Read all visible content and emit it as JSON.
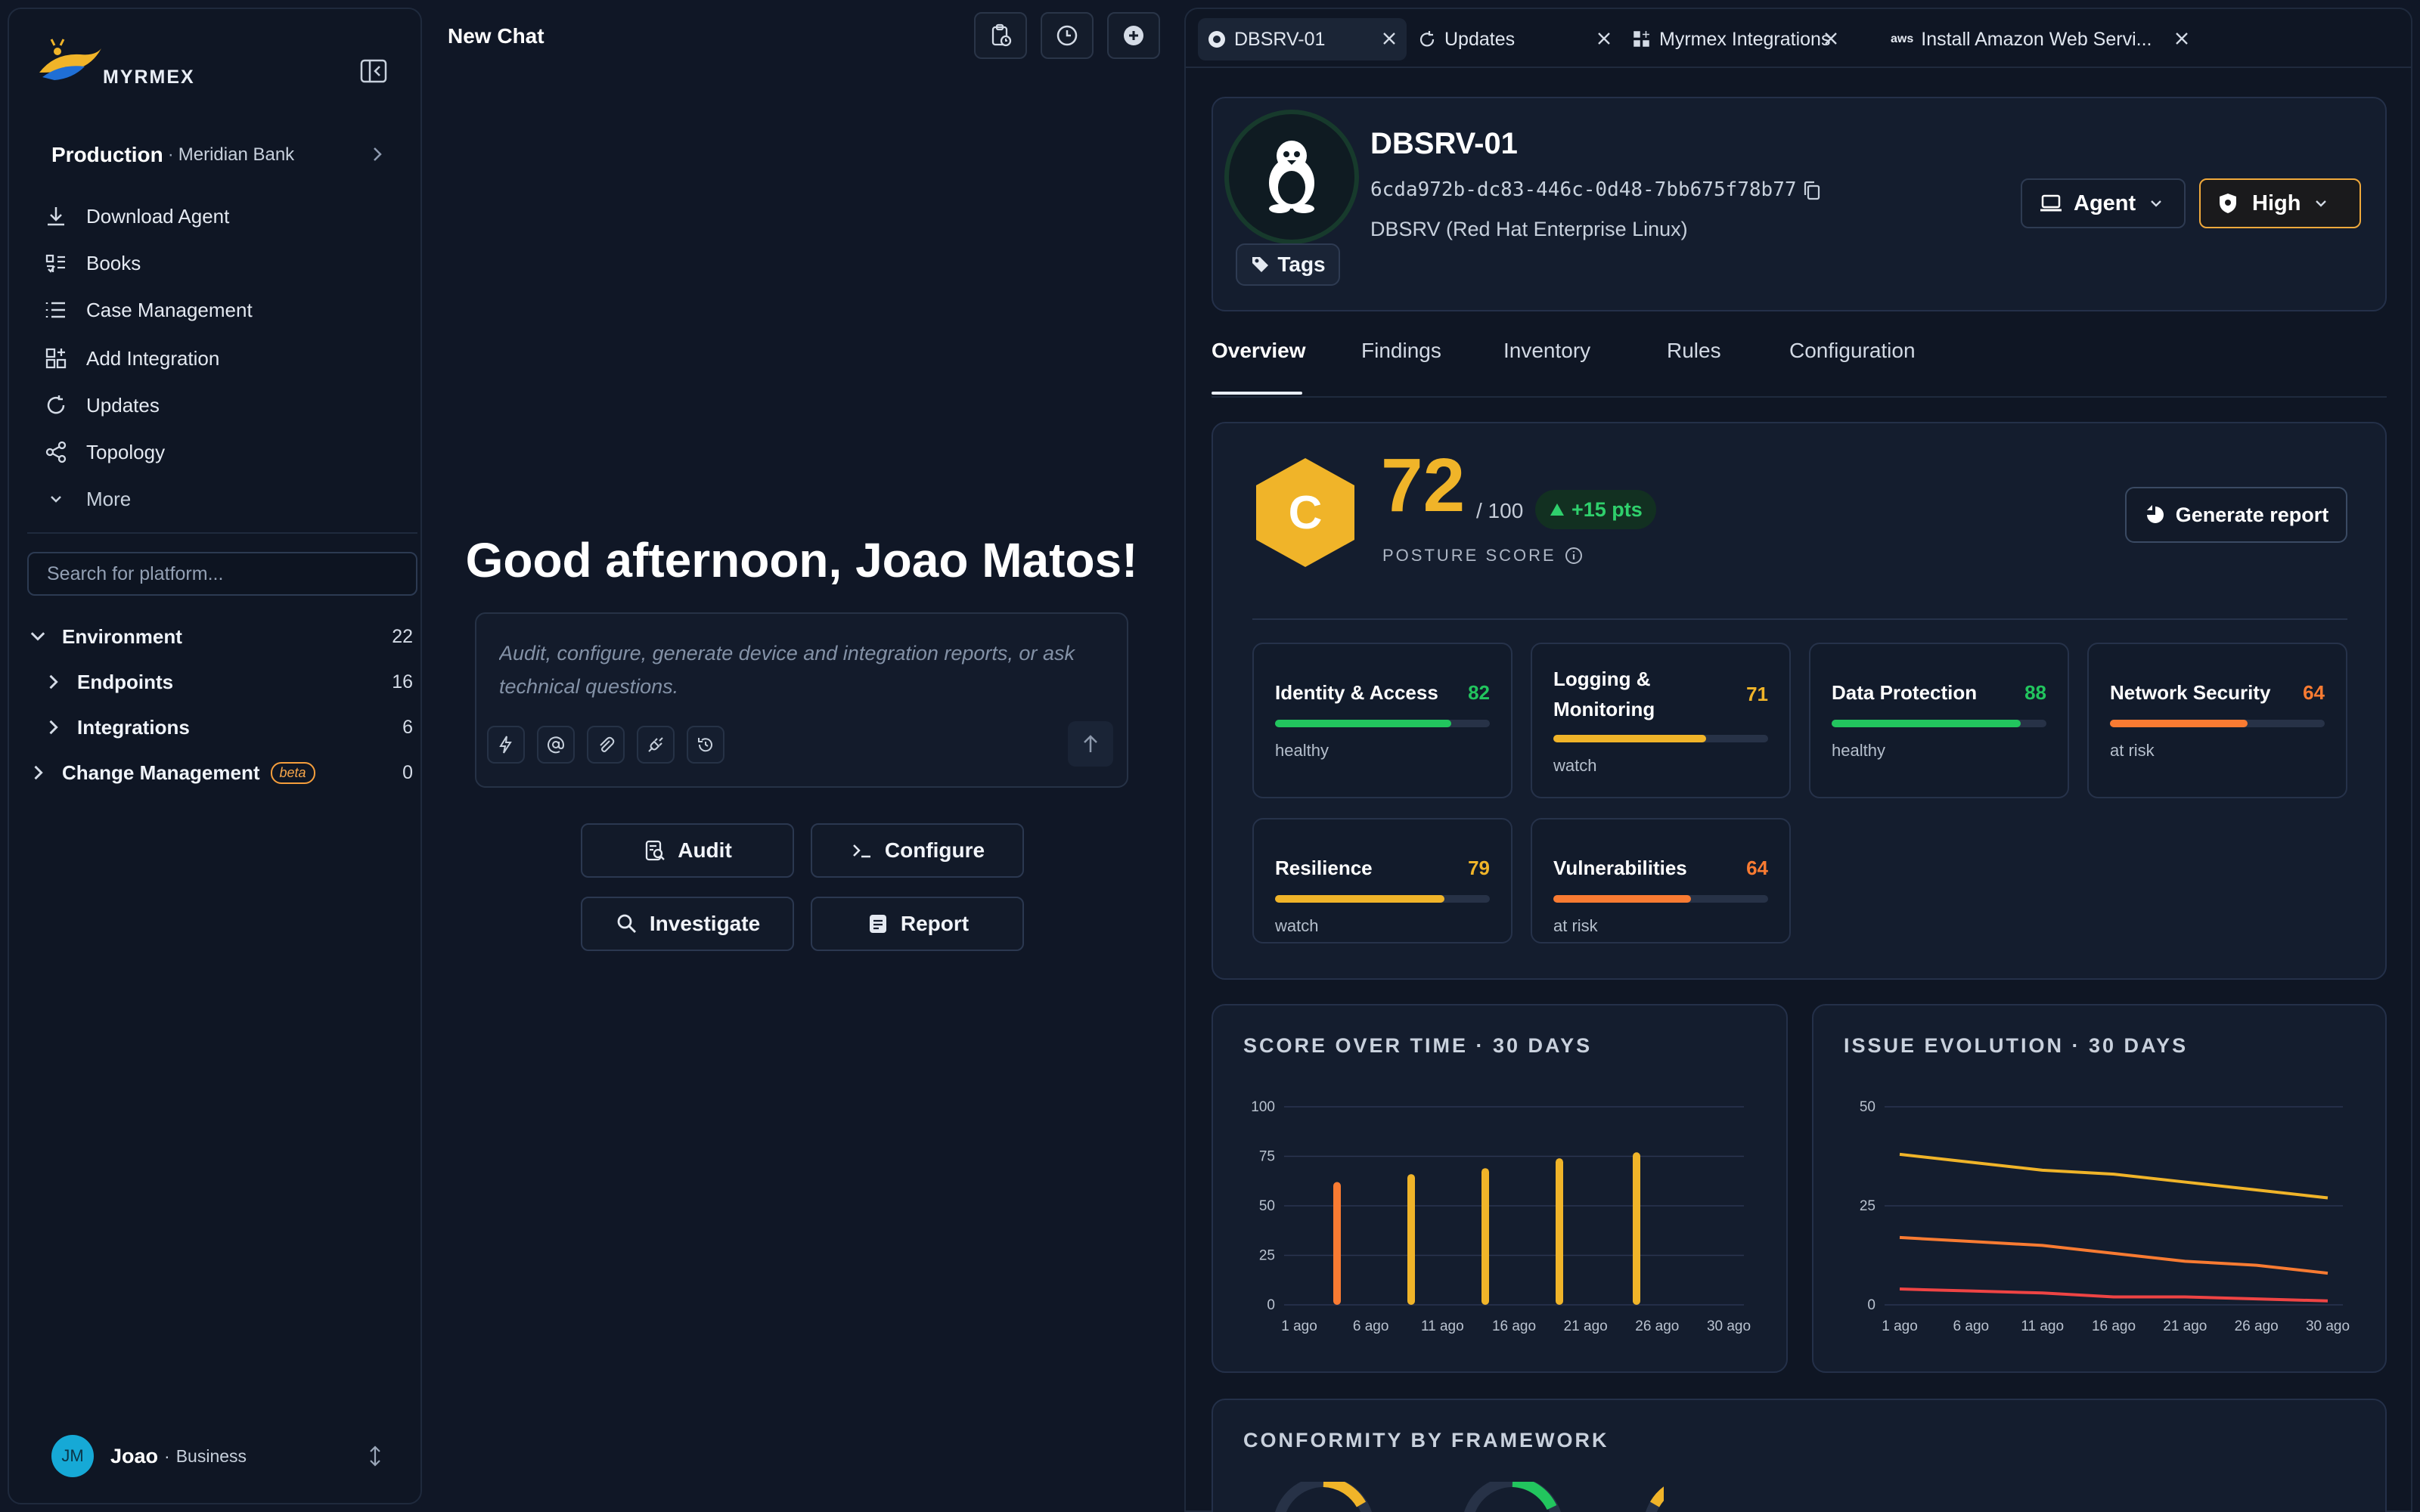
{
  "brand": {
    "name": "MYRMEX"
  },
  "sidebar": {
    "environment": "Production",
    "organization": "Meridian Bank",
    "nav": [
      {
        "label": "Download Agent",
        "icon": "download-icon"
      },
      {
        "label": "Books",
        "icon": "books-icon"
      },
      {
        "label": "Case Management",
        "icon": "list-icon"
      },
      {
        "label": "Add Integration",
        "icon": "add-integration-icon"
      },
      {
        "label": "Updates",
        "icon": "refresh-icon"
      },
      {
        "label": "Topology",
        "icon": "share-icon"
      },
      {
        "label": "More",
        "icon": "chevron-down-icon"
      }
    ],
    "search_placeholder": "Search for platform...",
    "tree": [
      {
        "label": "Environment",
        "count": "22"
      },
      {
        "label": "Endpoints",
        "count": "16"
      },
      {
        "label": "Integrations",
        "count": "6"
      },
      {
        "label": "Change Management",
        "count": "0",
        "badge": "beta"
      }
    ],
    "user": {
      "initials": "JM",
      "name": "Joao",
      "plan": "Business"
    }
  },
  "chat": {
    "title": "New Chat",
    "greeting": "Good afternoon, Joao Matos!",
    "placeholder": "Audit, configure, generate device and integration reports, or ask technical questions.",
    "actions": [
      "Audit",
      "Configure",
      "Investigate",
      "Report"
    ]
  },
  "tabs": [
    {
      "label": "DBSRV-01",
      "active": true
    },
    {
      "label": "Updates"
    },
    {
      "label": "Myrmex Integrations"
    },
    {
      "label": "Install Amazon Web Servi...",
      "prefix": "aws"
    }
  ],
  "asset": {
    "name": "DBSRV-01",
    "id": "6cda972b-dc83-446c-0d48-7bb675f78b77",
    "os": "DBSRV (Red Hat Enterprise Linux)",
    "tags_label": "Tags",
    "type_label": "Agent",
    "criticality_label": "High"
  },
  "subtabs": [
    "Overview",
    "Findings",
    "Inventory",
    "Rules",
    "Configuration"
  ],
  "posture": {
    "grade": "C",
    "score": "72",
    "out_of": "/ 100",
    "delta": "+15 pts",
    "label": "POSTURE SCORE",
    "report_button": "Generate report",
    "metrics": [
      {
        "name": "Identity & Access",
        "value": 82,
        "status": "healthy",
        "color": "#22c55e"
      },
      {
        "name": "Logging & Monitoring",
        "value": 71,
        "status": "watch",
        "color": "#f0b429"
      },
      {
        "name": "Data Protection",
        "value": 88,
        "status": "healthy",
        "color": "#22c55e"
      },
      {
        "name": "Network Security",
        "value": 64,
        "status": "at risk",
        "color": "#f97b32"
      },
      {
        "name": "Resilience",
        "value": 79,
        "status": "watch",
        "color": "#f0b429"
      },
      {
        "name": "Vulnerabilities",
        "value": 64,
        "status": "at risk",
        "color": "#f97b32"
      }
    ]
  },
  "chart_data": [
    {
      "type": "bar",
      "title": "SCORE OVER TIME · 30 DAYS",
      "categories": [
        "1 ago",
        "6 ago",
        "11 ago",
        "16 ago",
        "21 ago",
        "26 ago",
        "30 ago"
      ],
      "bars": [
        {
          "x": "1 ago",
          "value": 62,
          "color": "#f97b32"
        },
        {
          "x": "11 ago",
          "value": 66,
          "color": "#f0b429"
        },
        {
          "x": "16 ago",
          "value": 69,
          "color": "#f0b429"
        },
        {
          "x": "21 ago",
          "value": 74,
          "color": "#f0b429"
        },
        {
          "x": "30 ago",
          "value": 77,
          "color": "#f0b429"
        }
      ],
      "yticks": [
        0,
        25,
        50,
        75,
        100
      ],
      "ylim": [
        0,
        100
      ]
    },
    {
      "type": "line",
      "title": "ISSUE EVOLUTION · 30 DAYS",
      "categories": [
        "1 ago",
        "6 ago",
        "11 ago",
        "16 ago",
        "21 ago",
        "26 ago",
        "30 ago"
      ],
      "yticks": [
        0,
        25,
        50
      ],
      "ylim": [
        0,
        50
      ],
      "series": [
        {
          "color": "#f0b429",
          "values": [
            38,
            36,
            34,
            33,
            31,
            29,
            27
          ]
        },
        {
          "color": "#f97b32",
          "values": [
            17,
            16,
            15,
            13,
            11,
            10,
            8
          ]
        },
        {
          "color": "#ef4444",
          "values": [
            4,
            3.5,
            3,
            2,
            2,
            1.5,
            1
          ]
        }
      ]
    }
  ],
  "conformity": {
    "title": "CONFORMITY BY FRAMEWORK"
  },
  "colors": {
    "accent": "#f0b429",
    "bg": "#101726",
    "panel": "#141d2e"
  }
}
